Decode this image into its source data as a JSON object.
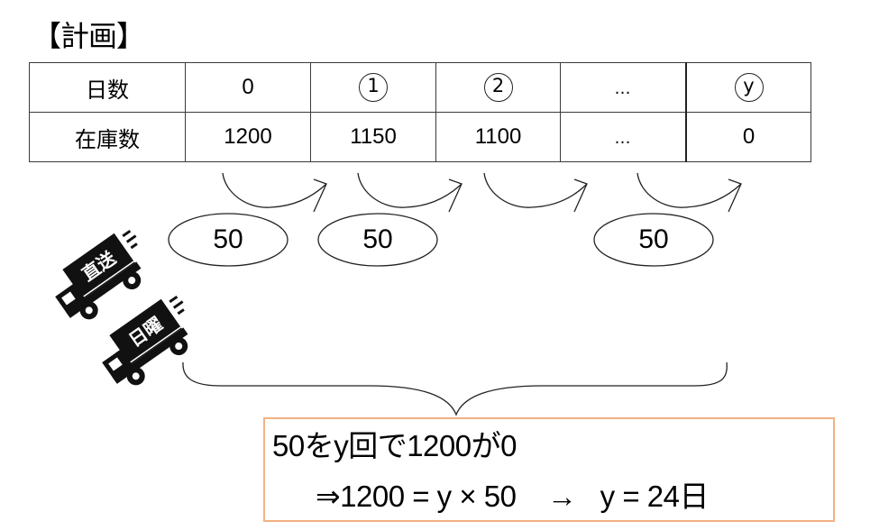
{
  "title": "【計画】",
  "table": {
    "rows": [
      {
        "header": "日数",
        "cells": [
          {
            "text": "0",
            "style": "plain"
          },
          {
            "text": "1",
            "style": "circled"
          },
          {
            "text": "2",
            "style": "circled"
          },
          {
            "text": "…",
            "style": "ellipsis"
          },
          {
            "text": "y",
            "style": "circled"
          }
        ]
      },
      {
        "header": "在庫数",
        "cells": [
          {
            "text": "1200",
            "style": "plain"
          },
          {
            "text": "1150",
            "style": "plain"
          },
          {
            "text": "1100",
            "style": "plain"
          },
          {
            "text": "…",
            "style": "ellipsis"
          },
          {
            "text": "0",
            "style": "plain"
          }
        ]
      }
    ]
  },
  "transitions": [
    {
      "from_column": 0,
      "to_column": 1,
      "amount": "50"
    },
    {
      "from_column": 1,
      "to_column": 2,
      "amount": "50"
    },
    {
      "from_column": 2,
      "to_column": 3,
      "amount": ""
    },
    {
      "from_column": 3,
      "to_column": 4,
      "amount": "50"
    }
  ],
  "trucks": [
    {
      "icon": "delivery-truck-icon",
      "label": "直送"
    },
    {
      "icon": "delivery-truck-icon",
      "label": "日曜"
    }
  ],
  "result": {
    "line1": "50をy回で1200が0",
    "line2": "⇒1200 = y × 50    →   y = 24日"
  },
  "colors": {
    "line": "#222222",
    "result_border": "#F4B183"
  }
}
